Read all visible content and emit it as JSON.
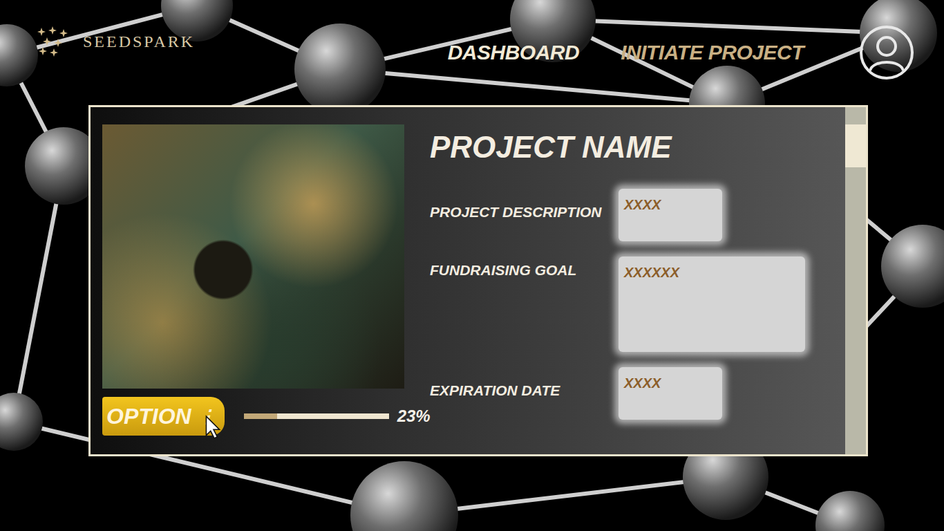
{
  "header": {
    "logo": "SEEDSPARK",
    "nav": [
      {
        "label": "DASHBOARD",
        "selected": false
      },
      {
        "label": "INITIATE PROJECT",
        "selected": true
      }
    ]
  },
  "card": {
    "title": "PROJECT NAME",
    "fields": [
      {
        "label": "PROJECT DESCRIPTION",
        "value": "XXXX"
      },
      {
        "label": "FUNDRAISING GOAL",
        "value": "XXXXXX"
      },
      {
        "label": "EXPIRATION DATE",
        "value": "XXXX"
      }
    ],
    "option_button": {
      "label": "OPTION",
      "icon": "⋮"
    },
    "progress": {
      "level": 0.23,
      "reading": "23%"
    }
  }
}
